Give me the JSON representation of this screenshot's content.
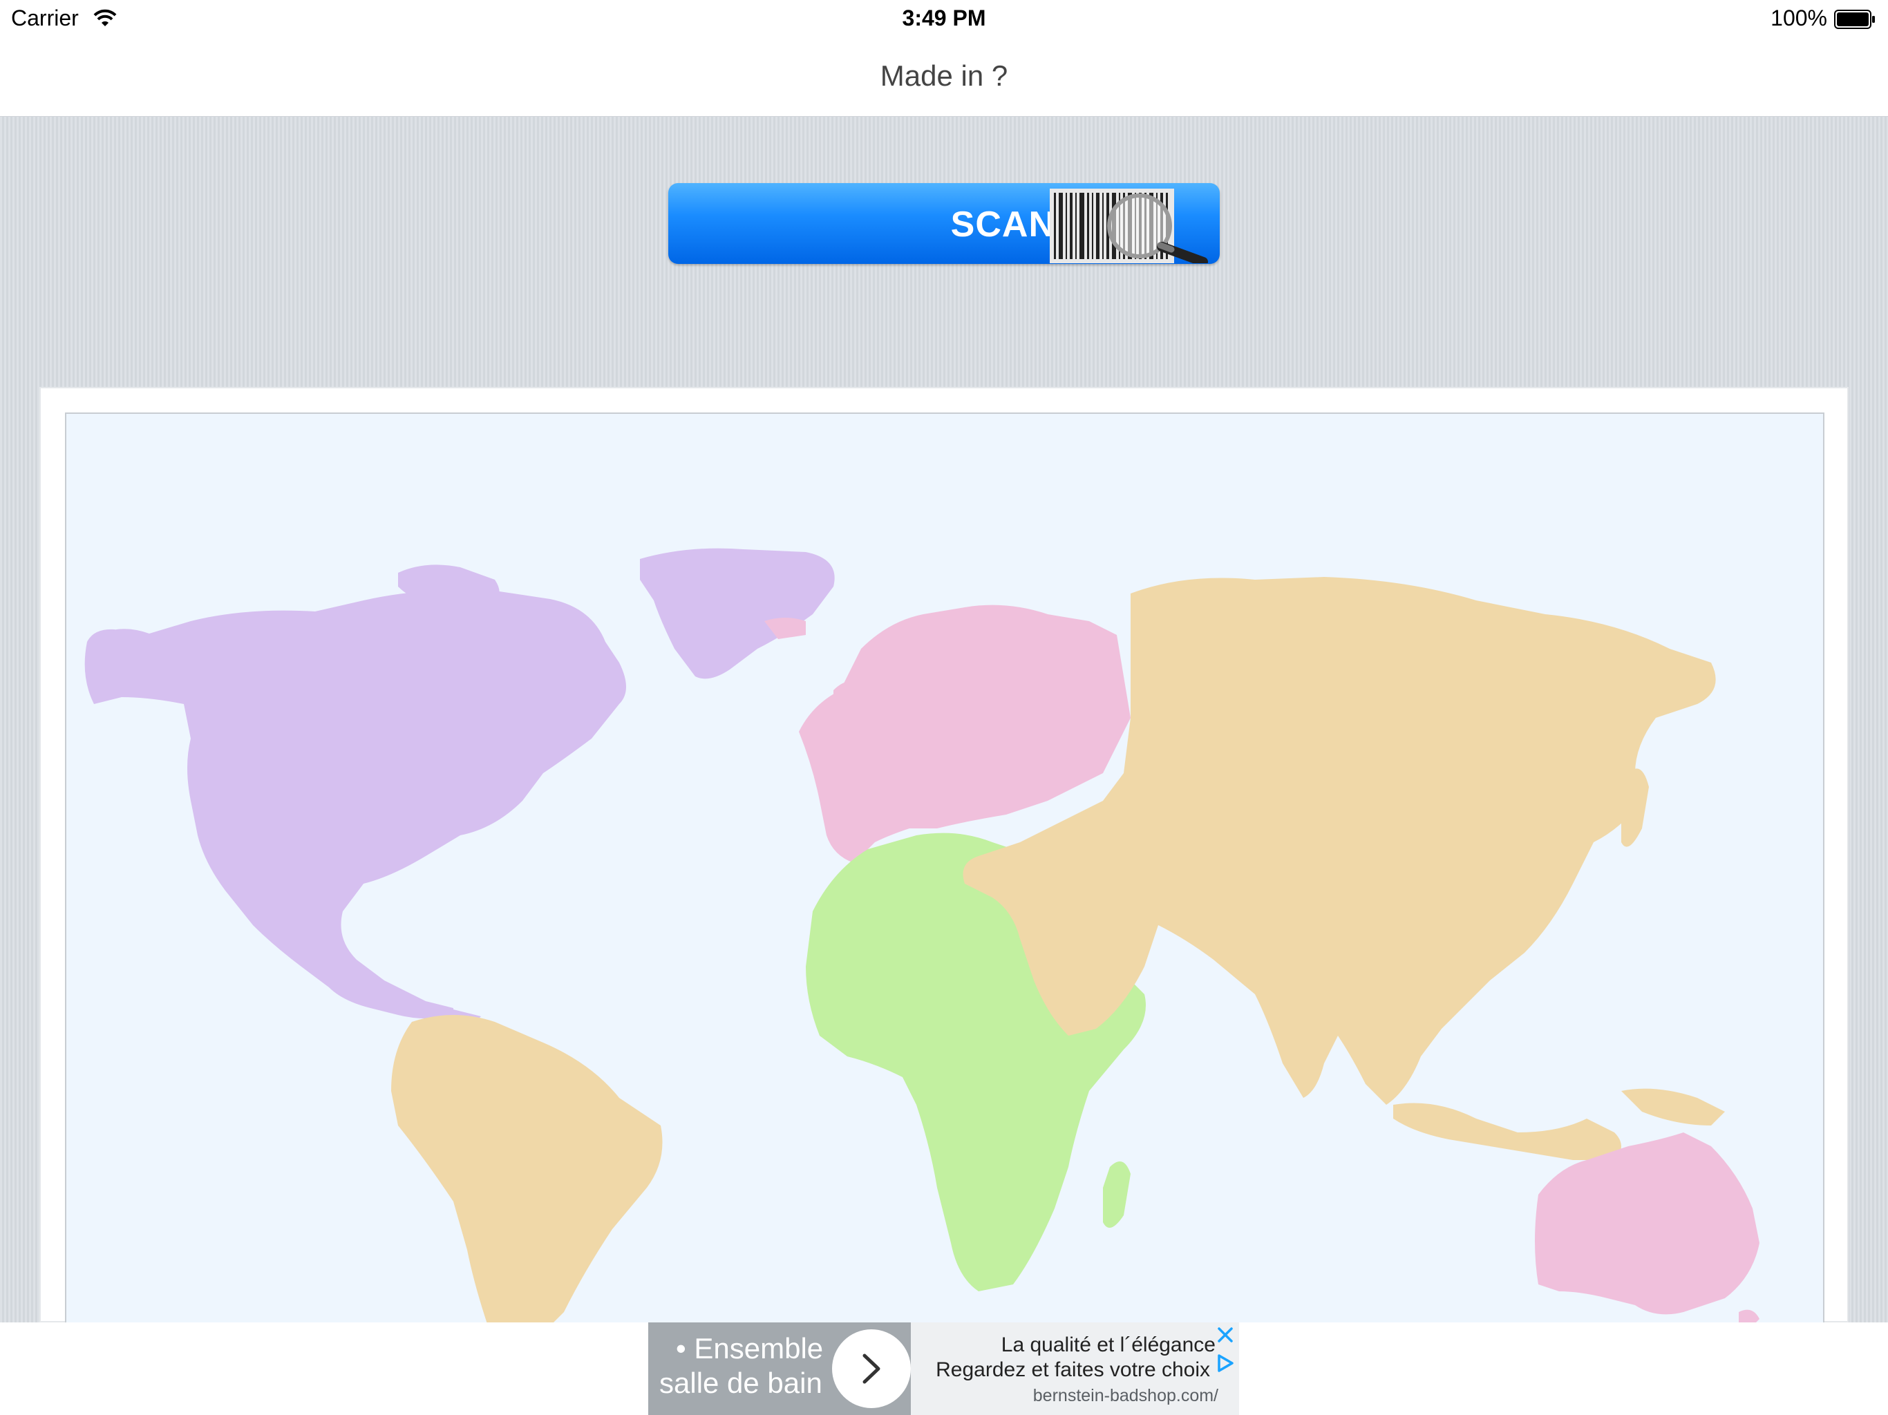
{
  "status_bar": {
    "carrier": "Carrier",
    "time": "3:49 PM",
    "battery": "100%"
  },
  "nav": {
    "title": "Made in ?"
  },
  "scan": {
    "label": "SCAN"
  },
  "map": {
    "colors": {
      "ocean": "#eef6fe",
      "north_america": "#d6c0f0",
      "south_america": "#f0d8a8",
      "europe": "#f0c0dc",
      "africa": "#c2f0a0",
      "asia": "#f0d8a8",
      "australia": "#f0c0dc"
    }
  },
  "ad": {
    "left_line1": "• Ensemble",
    "left_line2": "salle de bain",
    "headline": "La qualité et l´élégance",
    "body": "Regardez et faites votre choix",
    "url": "bernstein-badshop.com/"
  },
  "colors": {
    "accent_blue": "#1a8cff",
    "ad_info_blue": "#1aa3ff"
  }
}
